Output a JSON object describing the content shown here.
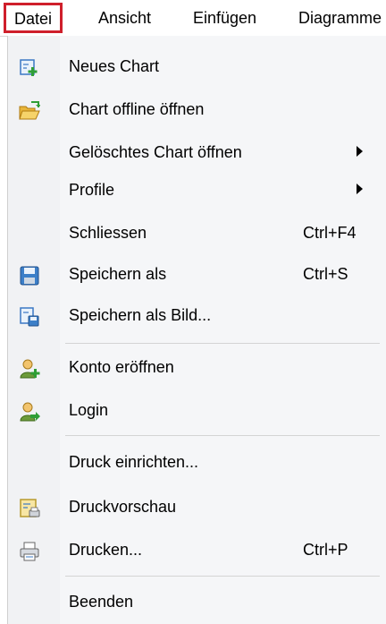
{
  "menubar": {
    "items": [
      "Datei",
      "Ansicht",
      "Einfügen",
      "Diagramme"
    ]
  },
  "menu": {
    "items": [
      {
        "label": "Neues Chart",
        "icon": "new-chart-icon"
      },
      {
        "label": "Chart offline öffnen",
        "icon": "open-folder-icon"
      },
      {
        "label": "Gelöschtes Chart öffnen"
      },
      {
        "label": "Profile"
      },
      {
        "label": "Schliessen",
        "shortcut": "Ctrl+F4"
      },
      {
        "label": "Speichern als",
        "shortcut": "Ctrl+S",
        "icon": "save-icon"
      },
      {
        "label": "Speichern als Bild...",
        "icon": "save-image-icon"
      },
      {
        "label": "Konto eröffnen",
        "icon": "add-user-icon"
      },
      {
        "label": "Login",
        "icon": "login-user-icon"
      },
      {
        "label": "Druck einrichten..."
      },
      {
        "label": "Druckvorschau",
        "icon": "print-preview-icon"
      },
      {
        "label": "Drucken...",
        "shortcut": "Ctrl+P",
        "icon": "printer-icon"
      },
      {
        "label": "Beenden"
      }
    ]
  },
  "colors": {
    "active_outline": "#cf1f2b",
    "menu_background": "#f5f6f8"
  }
}
